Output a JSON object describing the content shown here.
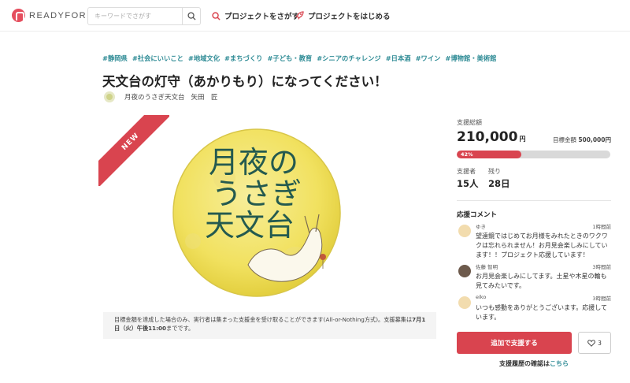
{
  "header": {
    "logo_text": "READYFOR",
    "search_placeholder": "キーワードでさがす",
    "nav": [
      {
        "label": "プロジェクトをさがす",
        "icon": "search-icon"
      },
      {
        "label": "プロジェクトをはじめる",
        "icon": "rocket-icon"
      }
    ]
  },
  "tags": [
    "#静岡県",
    "#社会にいいこと",
    "#地域文化",
    "#まちづくり",
    "#子ども・教育",
    "#シニアのチャレンジ",
    "#日本酒",
    "#ワイン",
    "#博物館・美術館"
  ],
  "project": {
    "title": "天文台の灯守（あかりもり）になってください！",
    "owner_org": "月夜のうさぎ天文台",
    "owner_name": "矢田　匠"
  },
  "hero": {
    "badge": "NEW",
    "image_text": [
      "月夜の",
      "うさぎ",
      "天文台"
    ],
    "colors": {
      "moon": "#f3e46a",
      "text": "#245a4f"
    }
  },
  "notice": {
    "text": "目標金額を達成した場合のみ、実行者は集まった支援金を受け取ることができます(All-or-Nothing方式)。支援募集は",
    "deadline": "7月1日（火）午後11:00",
    "suffix": "までです。"
  },
  "funding": {
    "total_label": "支援総額",
    "total_value": "210,000",
    "currency": "円",
    "goal_label": "目標金額",
    "goal_value": "500,000円",
    "percent_label": "42%",
    "percent": 42,
    "supporters_label": "支援者",
    "supporters_value": "15人",
    "remaining_label": "残り",
    "remaining_value": "28日"
  },
  "comments": {
    "title": "応援コメント",
    "items": [
      {
        "name": "ゆき",
        "time": "1時間前",
        "text": "望遠鏡ではじめてお月様をみれたときのワクワクは忘れられません！お月見会楽しみにしています！！プロジェクト応援しています！"
      },
      {
        "name": "佐藤 智明",
        "time": "3時間前",
        "text": "お月見会楽しみにしてます。土星や木星の輪も見てみたいです。"
      },
      {
        "name": "eiko",
        "time": "3時間前",
        "text": "いつも感動をありがとうございます。応援しています。"
      }
    ]
  },
  "actions": {
    "support_label": "追加で支援する",
    "like_count": "3",
    "history_text": "支援履歴の確認は",
    "history_link": "こちら"
  },
  "accent": "#d9444f",
  "tag_color": "#2e8b95"
}
